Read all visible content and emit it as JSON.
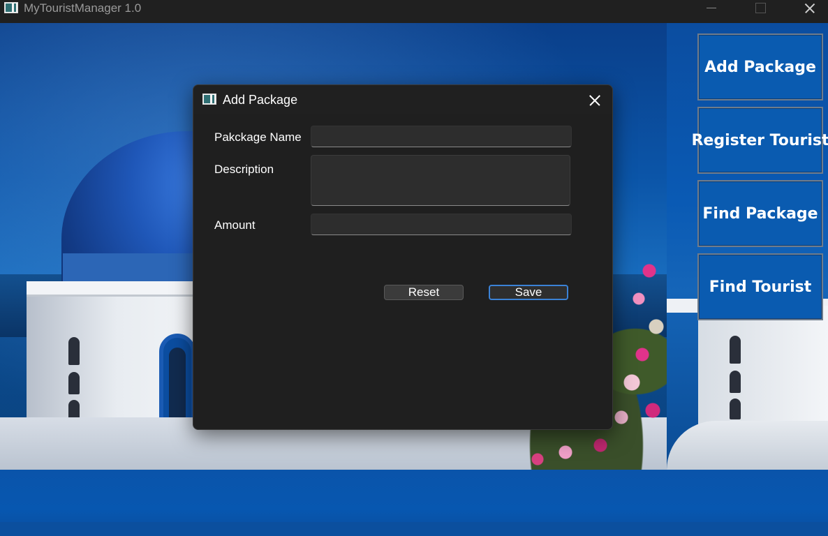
{
  "app": {
    "title": "MyTouristManager 1.0",
    "icon": "app-window-icon"
  },
  "window_controls": {
    "minimize": "minimize-icon",
    "maximize": "maximize-icon",
    "close": "close-icon"
  },
  "sidebar": {
    "buttons": [
      {
        "label": "Add Package"
      },
      {
        "label": "Register Tourist"
      },
      {
        "label": "Find Package"
      },
      {
        "label": "Find Tourist"
      }
    ],
    "button_color": "#0a5bb0"
  },
  "dialog": {
    "title": "Add Package",
    "icon": "app-window-icon",
    "fields": {
      "package_name": {
        "label": "Pakckage Name",
        "value": "",
        "placeholder": ""
      },
      "description": {
        "label": "Description",
        "value": "",
        "placeholder": ""
      },
      "amount": {
        "label": "Amount",
        "value": "",
        "placeholder": ""
      }
    },
    "buttons": {
      "reset": "Reset",
      "save": "Save"
    },
    "accent_color": "#3b82d6"
  }
}
